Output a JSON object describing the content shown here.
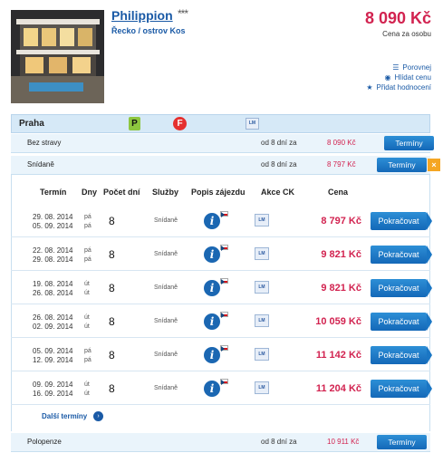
{
  "hotel": {
    "name": "Philippion",
    "stars": "***",
    "location": "Řecko / ostrov Kos",
    "price": "8 090 Kč",
    "price_note": "Cena za osobu"
  },
  "side_links": [
    {
      "icon": "list-icon",
      "label": "Porovnej"
    },
    {
      "icon": "eye-icon",
      "label": "Hlídat cenu"
    },
    {
      "icon": "star-icon",
      "label": "Přidat hodnocení"
    }
  ],
  "departure": {
    "city": "Praha",
    "icons": [
      "parking-icon",
      "fly-icon",
      "last-minute-icon"
    ],
    "p_label": "P",
    "f_label": "F",
    "lm_label": "LM"
  },
  "boards": [
    {
      "name": "Bez stravy",
      "days": "od 8 dní za",
      "price": "8 090 Kč",
      "button": "Termíny"
    },
    {
      "name": "Snídaně",
      "days": "od 8 dní za",
      "price": "8 797 Kč",
      "button": "Termíny",
      "close": "×"
    },
    {
      "name": "Polopenze",
      "days": "od 8 dní za",
      "price": "10 911 Kč",
      "button": "Termíny"
    }
  ],
  "table": {
    "headers": {
      "term": "Termín",
      "days": "Dny",
      "nights": "Počet dní",
      "services": "Služby",
      "desc": "Popis zájezdu",
      "action": "Akce CK",
      "price": "Cena"
    },
    "info_label": "i",
    "lm_label": "LM",
    "go_label": "Pokračovat",
    "rows": [
      {
        "from": "29. 08. 2014",
        "to": "05. 09. 2014",
        "d1": "pá",
        "d2": "pá",
        "nights": "8",
        "board": "Snídaně",
        "price": "8 797 Kč"
      },
      {
        "from": "22. 08. 2014",
        "to": "29. 08. 2014",
        "d1": "pá",
        "d2": "pá",
        "nights": "8",
        "board": "Snídaně",
        "price": "9 821 Kč"
      },
      {
        "from": "19. 08. 2014",
        "to": "26. 08. 2014",
        "d1": "út",
        "d2": "út",
        "nights": "8",
        "board": "Snídaně",
        "price": "9 821 Kč"
      },
      {
        "from": "26. 08. 2014",
        "to": "02. 09. 2014",
        "d1": "út",
        "d2": "út",
        "nights": "8",
        "board": "Snídaně",
        "price": "10 059 Kč"
      },
      {
        "from": "05. 09. 2014",
        "to": "12. 09. 2014",
        "d1": "pá",
        "d2": "pá",
        "nights": "8",
        "board": "Snídaně",
        "price": "11 142 Kč"
      },
      {
        "from": "09. 09. 2014",
        "to": "16. 09. 2014",
        "d1": "út",
        "d2": "út",
        "nights": "8",
        "board": "Snídaně",
        "price": "11 204 Kč"
      }
    ],
    "more": "Další termíny",
    "more_icon": "›"
  },
  "colors": {
    "accent": "#1a5aa6",
    "price": "#d22350",
    "row_bg": "#eaf4fb",
    "button": "#1a76c4"
  }
}
